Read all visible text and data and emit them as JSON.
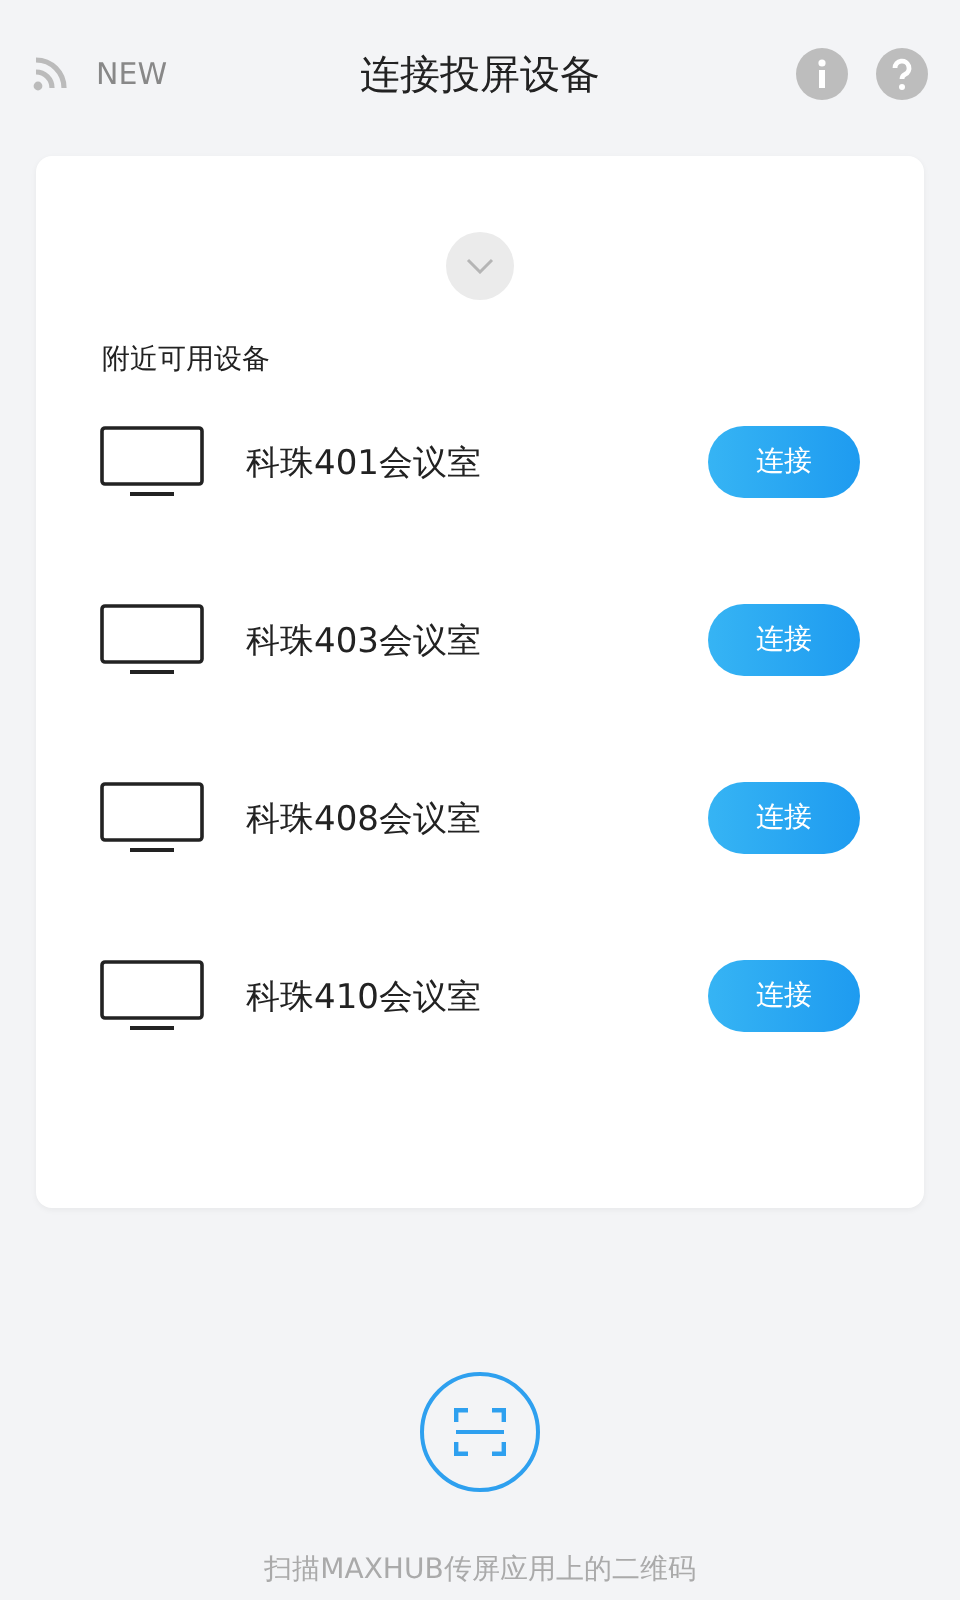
{
  "header": {
    "new_label": "NEW",
    "title": "连接投屏设备"
  },
  "section_label": "附近可用设备",
  "devices": [
    {
      "name": "科珠401会议室",
      "button": "连接"
    },
    {
      "name": "科珠403会议室",
      "button": "连接"
    },
    {
      "name": "科珠408会议室",
      "button": "连接"
    },
    {
      "name": "科珠410会议室",
      "button": "连接"
    }
  ],
  "scan_hint": "扫描MAXHUB传屏应用上的二维码"
}
